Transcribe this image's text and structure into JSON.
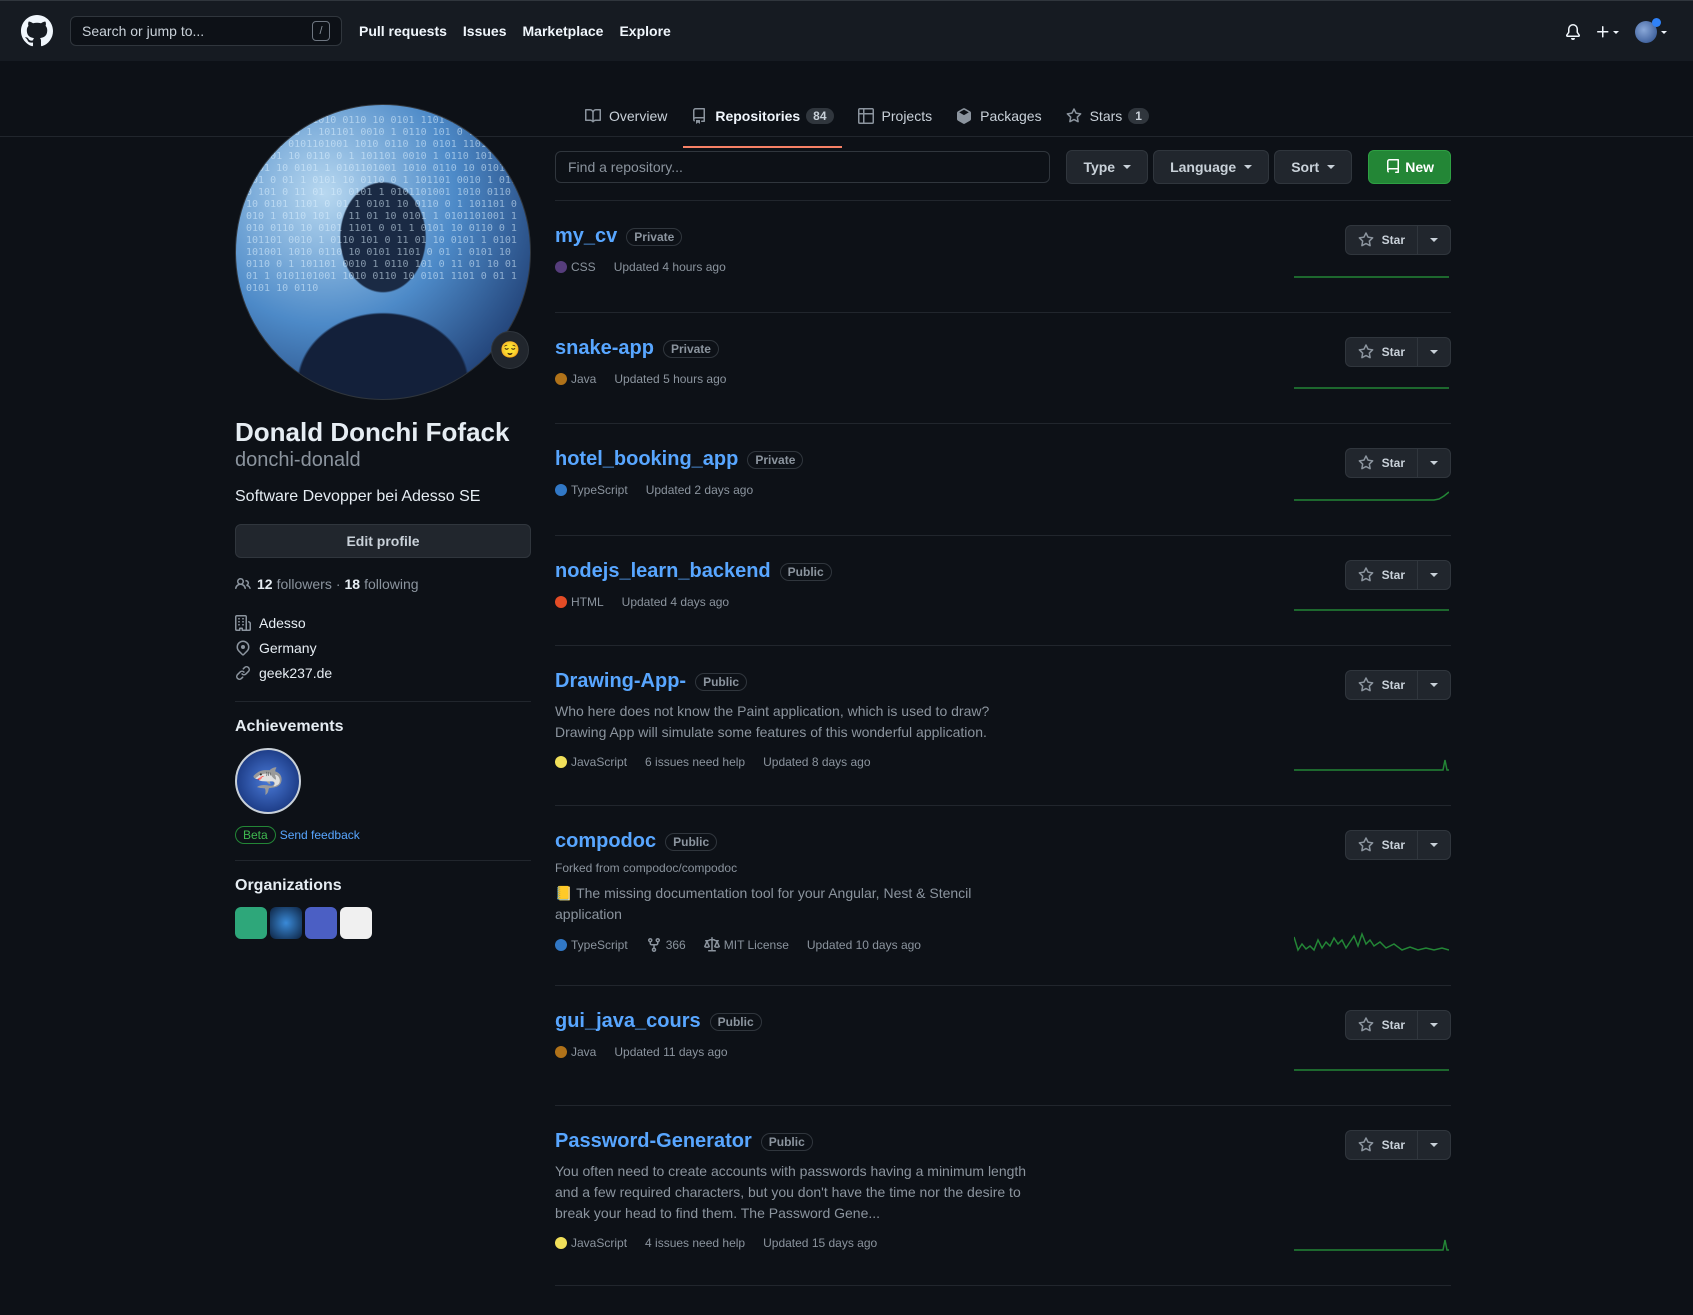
{
  "topnav": {
    "search_placeholder": "Search or jump to...",
    "slash": "/",
    "links": [
      "Pull requests",
      "Issues",
      "Marketplace",
      "Explore"
    ]
  },
  "tabs": {
    "overview": "Overview",
    "repositories": "Repositories",
    "repositories_count": "84",
    "projects": "Projects",
    "packages": "Packages",
    "stars": "Stars",
    "stars_count": "1"
  },
  "profile": {
    "name": "Donald Donchi Fofack",
    "login": "donchi-donald",
    "bio": "Software Devopper bei Adesso SE",
    "edit_label": "Edit profile",
    "followers": "12",
    "followers_label": "followers",
    "sep": "·",
    "following": "18",
    "following_label": "following",
    "company": "Adesso",
    "location": "Germany",
    "website": "geek237.de",
    "status_emoji": "😌"
  },
  "achievements": {
    "title": "Achievements",
    "beta": "Beta",
    "feedback": "Send feedback"
  },
  "organizations": {
    "title": "Organizations",
    "colors": [
      "#2ea77a",
      "#1c4d7a",
      "#4b5fc4",
      "#f0f0f0"
    ]
  },
  "filters": {
    "find_placeholder": "Find a repository...",
    "type": "Type",
    "language": "Language",
    "sort": "Sort",
    "new": "New"
  },
  "star_label": "Star",
  "repos": [
    {
      "name": "my_cv",
      "visibility": "Private",
      "lang": "CSS",
      "lang_color": "#563d7c",
      "updated": "Updated 4 hours ago",
      "height": 112,
      "spark": "flat"
    },
    {
      "name": "snake-app",
      "visibility": "Private",
      "lang": "Java",
      "lang_color": "#b07219",
      "updated": "Updated 5 hours ago",
      "height": 111,
      "spark": "flat"
    },
    {
      "name": "hotel_booking_app",
      "visibility": "Private",
      "lang": "TypeScript",
      "lang_color": "#3178c6",
      "updated": "Updated 2 days ago",
      "height": 112,
      "spark": "tail"
    },
    {
      "name": "nodejs_learn_backend",
      "visibility": "Public",
      "lang": "HTML",
      "lang_color": "#e34c26",
      "updated": "Updated 4 days ago",
      "height": 110,
      "spark": "flat"
    },
    {
      "name": "Drawing-App-",
      "visibility": "Public",
      "desc": "Who here does not know the Paint application, which is used to draw? Drawing App will simulate some features of this wonderful application.",
      "lang": "JavaScript",
      "lang_color": "#f1e05a",
      "issues": "6 issues need help",
      "updated": "Updated 8 days ago",
      "height": 160,
      "spark": "spike"
    },
    {
      "name": "compodoc",
      "visibility": "Public",
      "forked": "Forked from compodoc/compodoc",
      "desc": "📒 The missing documentation tool for your Angular, Nest & Stencil application",
      "lang": "TypeScript",
      "lang_color": "#3178c6",
      "forks": "366",
      "license": "MIT License",
      "updated": "Updated 10 days ago",
      "height": 180,
      "spark": "busy"
    },
    {
      "name": "gui_java_cours",
      "visibility": "Public",
      "lang": "Java",
      "lang_color": "#b07219",
      "updated": "Updated 11 days ago",
      "height": 120,
      "spark": "flat"
    },
    {
      "name": "Password-Generator",
      "visibility": "Public",
      "desc": "You often need to create accounts with passwords having a minimum length and a few required characters, but you don't have the time nor the desire to break your head to find them. The Password Gene...",
      "lang": "JavaScript",
      "lang_color": "#f1e05a",
      "issues": "4 issues need help",
      "updated": "Updated 15 days ago",
      "height": 180,
      "spark": "spike"
    }
  ]
}
